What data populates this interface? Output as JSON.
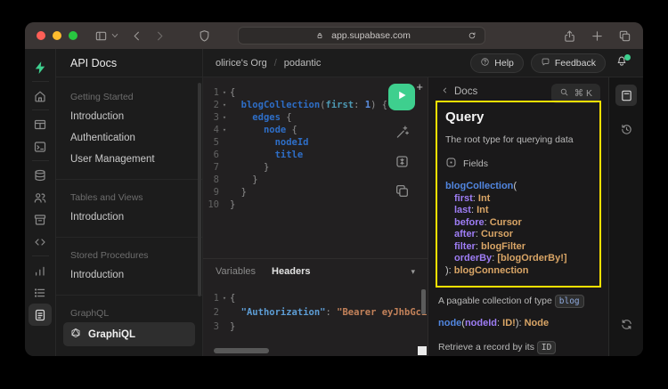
{
  "colors": {
    "accent": "#3ecf8e",
    "highlight": "#ffe100",
    "syn-field": "#2e6ec7",
    "syn-arg": "#4d9ab5",
    "syn-num": "#5b8ee0",
    "syn-key": "#5d9dd5",
    "syn-str": "#c4825a",
    "doc-field": "#5186e0",
    "doc-arg": "#9e7df5",
    "doc-type": "#d9a566"
  },
  "browser": {
    "url": "app.supabase.com"
  },
  "rail": {
    "items": [
      {
        "icon": "supabase-logo",
        "sep_after": true
      },
      {
        "icon": "home-icon",
        "sep_after": true
      },
      {
        "icon": "table-editor-icon"
      },
      {
        "icon": "sql-editor-icon",
        "sep_after": true
      },
      {
        "icon": "database-icon"
      },
      {
        "icon": "auth-icon"
      },
      {
        "icon": "storage-icon"
      },
      {
        "icon": "edge-functions-icon",
        "sep_after": true
      },
      {
        "icon": "reports-icon"
      },
      {
        "icon": "logs-icon"
      },
      {
        "icon": "api-docs-icon",
        "active": true
      }
    ]
  },
  "sidebar": {
    "title": "API Docs",
    "sections": [
      {
        "heading": "Getting Started",
        "items": [
          {
            "label": "Introduction"
          },
          {
            "label": "Authentication"
          },
          {
            "label": "User Management"
          }
        ]
      },
      {
        "heading": "Tables and Views",
        "items": [
          {
            "label": "Introduction"
          }
        ]
      },
      {
        "heading": "Stored Procedures",
        "items": [
          {
            "label": "Introduction"
          }
        ]
      },
      {
        "heading": "GraphQL",
        "items": [
          {
            "label": "GraphiQL",
            "active": true,
            "icon": "graphql-icon"
          }
        ]
      }
    ]
  },
  "header": {
    "breadcrumb": {
      "org": "olirice's Org",
      "separator": "/",
      "project": "podantic"
    },
    "help_label": "Help",
    "feedback_label": "Feedback"
  },
  "editor": {
    "query_lines": [
      {
        "num": "1",
        "fold": true,
        "tokens": [
          [
            "p",
            "{"
          ]
        ]
      },
      {
        "num": "2",
        "fold": true,
        "tokens": [
          [
            "w",
            "  "
          ],
          [
            "f",
            "blogCollection"
          ],
          [
            "p",
            "("
          ],
          [
            "a",
            "first"
          ],
          [
            "p",
            ": "
          ],
          [
            "n",
            "1"
          ],
          [
            "p",
            ") {"
          ]
        ]
      },
      {
        "num": "3",
        "fold": true,
        "tokens": [
          [
            "w",
            "    "
          ],
          [
            "f",
            "edges"
          ],
          [
            "p",
            " {"
          ]
        ]
      },
      {
        "num": "4",
        "fold": true,
        "tokens": [
          [
            "w",
            "      "
          ],
          [
            "f",
            "node"
          ],
          [
            "p",
            " {"
          ]
        ]
      },
      {
        "num": "5",
        "fold": false,
        "tokens": [
          [
            "w",
            "        "
          ],
          [
            "f",
            "nodeId"
          ]
        ]
      },
      {
        "num": "6",
        "fold": false,
        "tokens": [
          [
            "w",
            "        "
          ],
          [
            "f",
            "title"
          ]
        ]
      },
      {
        "num": "7",
        "fold": false,
        "tokens": [
          [
            "w",
            "      "
          ],
          [
            "p",
            "}"
          ]
        ]
      },
      {
        "num": "8",
        "fold": false,
        "tokens": [
          [
            "w",
            "    "
          ],
          [
            "p",
            "}"
          ]
        ]
      },
      {
        "num": "9",
        "fold": false,
        "tokens": [
          [
            "w",
            "  "
          ],
          [
            "p",
            "}"
          ]
        ]
      },
      {
        "num": "10",
        "fold": false,
        "tokens": [
          [
            "p",
            "}"
          ]
        ]
      }
    ],
    "tabs": [
      {
        "label": "Variables",
        "active": false
      },
      {
        "label": "Headers",
        "active": true
      }
    ],
    "header_lines": [
      {
        "num": "1",
        "fold": true,
        "tokens": [
          [
            "p",
            "{"
          ]
        ]
      },
      {
        "num": "2",
        "fold": false,
        "tokens": [
          [
            "w",
            "  "
          ],
          [
            "k",
            "\"Authorization\""
          ],
          [
            "p",
            ": "
          ],
          [
            "s",
            "\"Bearer eyJhbGci"
          ]
        ]
      },
      {
        "num": "3",
        "fold": false,
        "tokens": [
          [
            "p",
            "}"
          ]
        ]
      }
    ]
  },
  "docs": {
    "back_label": "Docs",
    "search_shortcut": "⌘ K",
    "title": "Query",
    "description": "The root type for querying data",
    "fields_label": "Fields",
    "signature_lines": [
      {
        "indent": 0,
        "tokens": [
          [
            "df",
            "blogCollection"
          ],
          [
            "dp",
            "("
          ]
        ]
      },
      {
        "indent": 1,
        "tokens": [
          [
            "da",
            "first"
          ],
          [
            "dp",
            ": "
          ],
          [
            "dt",
            "Int"
          ]
        ]
      },
      {
        "indent": 1,
        "tokens": [
          [
            "da",
            "last"
          ],
          [
            "dp",
            ": "
          ],
          [
            "dt",
            "Int"
          ]
        ]
      },
      {
        "indent": 1,
        "tokens": [
          [
            "da",
            "before"
          ],
          [
            "dp",
            ": "
          ],
          [
            "dt",
            "Cursor"
          ]
        ]
      },
      {
        "indent": 1,
        "tokens": [
          [
            "da",
            "after"
          ],
          [
            "dp",
            ": "
          ],
          [
            "dt",
            "Cursor"
          ]
        ]
      },
      {
        "indent": 1,
        "tokens": [
          [
            "da",
            "filter"
          ],
          [
            "dp",
            ": "
          ],
          [
            "dt",
            "blogFilter"
          ]
        ]
      },
      {
        "indent": 1,
        "tokens": [
          [
            "da",
            "orderBy"
          ],
          [
            "dp",
            ": "
          ],
          [
            "dt",
            "[blogOrderBy!]"
          ]
        ]
      },
      {
        "indent": 0,
        "tokens": [
          [
            "dp",
            "): "
          ],
          [
            "dt",
            "blogConnection"
          ]
        ]
      }
    ],
    "collection_desc_prefix": "A pagable collection of type",
    "collection_chip": "blog",
    "node_signature": [
      [
        "df",
        "node"
      ],
      [
        "dp",
        "("
      ],
      [
        "da",
        "nodeId"
      ],
      [
        "dp",
        ": "
      ],
      [
        "dt",
        "ID!"
      ],
      [
        "dp",
        "): "
      ],
      [
        "dt",
        "Node"
      ]
    ],
    "node_desc_prefix": "Retrieve a record by its",
    "node_chip": "ID"
  }
}
